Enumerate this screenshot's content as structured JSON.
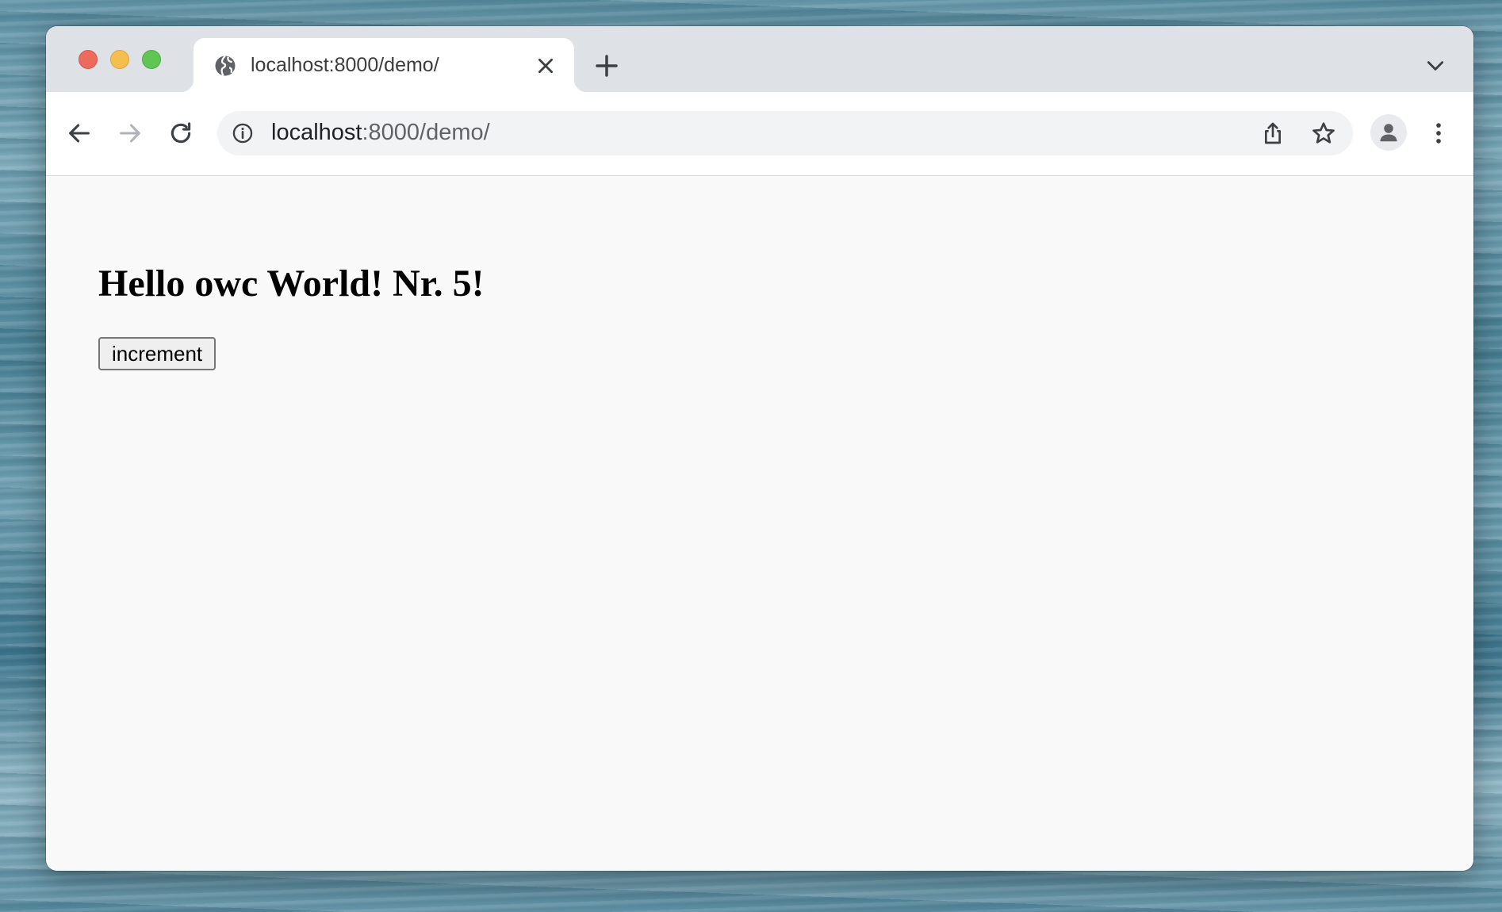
{
  "browser": {
    "tab": {
      "title": "localhost:8000/demo/",
      "favicon": "globe-icon"
    },
    "address_bar": {
      "host": "localhost",
      "rest": ":8000/demo/"
    },
    "icons": {
      "back": "arrow-left-icon",
      "forward": "arrow-right-icon",
      "reload": "reload-icon",
      "site_info": "info-icon",
      "share": "share-icon",
      "bookmark": "star-icon",
      "profile": "person-icon",
      "menu": "kebab-menu-icon",
      "new_tab": "plus-icon",
      "tab_close": "close-icon",
      "tab_search": "chevron-down-icon"
    },
    "traffic_lights": {
      "close": "#ed6a5e",
      "minimize": "#f5bf4f",
      "maximize": "#61c554"
    }
  },
  "page": {
    "heading": "Hello owc World! Nr. 5!",
    "button_label": "increment"
  }
}
